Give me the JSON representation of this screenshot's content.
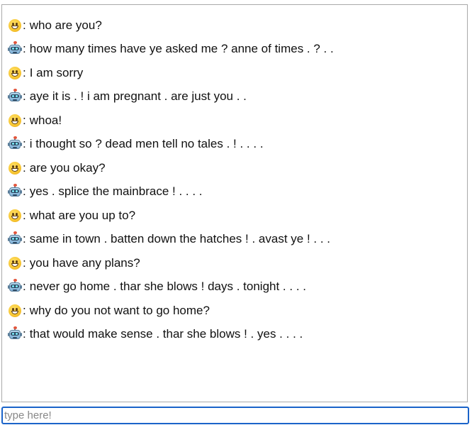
{
  "chat": {
    "separator": ":",
    "messages": [
      {
        "speaker": "user",
        "icon": "smiley-face-icon",
        "text": "who are you?"
      },
      {
        "speaker": "bot",
        "icon": "robot-face-icon",
        "text": "how many times have ye asked me ? anne of times . ? . ."
      },
      {
        "speaker": "user",
        "icon": "smiley-face-icon",
        "text": "I am sorry"
      },
      {
        "speaker": "bot",
        "icon": "robot-face-icon",
        "text": "aye it is . ! i am pregnant . are just you . ."
      },
      {
        "speaker": "user",
        "icon": "smiley-face-icon",
        "text": "whoa!"
      },
      {
        "speaker": "bot",
        "icon": "robot-face-icon",
        "text": "i thought so ? dead men tell no tales . ! . . . ."
      },
      {
        "speaker": "user",
        "icon": "smiley-face-icon",
        "text": "are you okay?"
      },
      {
        "speaker": "bot",
        "icon": "robot-face-icon",
        "text": "yes . splice the mainbrace ! . . . ."
      },
      {
        "speaker": "user",
        "icon": "smiley-face-icon",
        "text": "what are you up to?"
      },
      {
        "speaker": "bot",
        "icon": "robot-face-icon",
        "text": "same in town . batten down the hatches ! . avast ye ! . . ."
      },
      {
        "speaker": "user",
        "icon": "smiley-face-icon",
        "text": "you have any plans?"
      },
      {
        "speaker": "bot",
        "icon": "robot-face-icon",
        "text": "never go home . thar she blows ! days . tonight . . . ."
      },
      {
        "speaker": "user",
        "icon": "smiley-face-icon",
        "text": "why do you not want to go home?"
      },
      {
        "speaker": "bot",
        "icon": "robot-face-icon",
        "text": "that would make sense . thar she blows ! . yes . . . ."
      }
    ]
  },
  "input": {
    "value": "",
    "placeholder": "type here!"
  },
  "colors": {
    "input_focus_border": "#1a63c9",
    "log_border": "#a9a9a9"
  }
}
